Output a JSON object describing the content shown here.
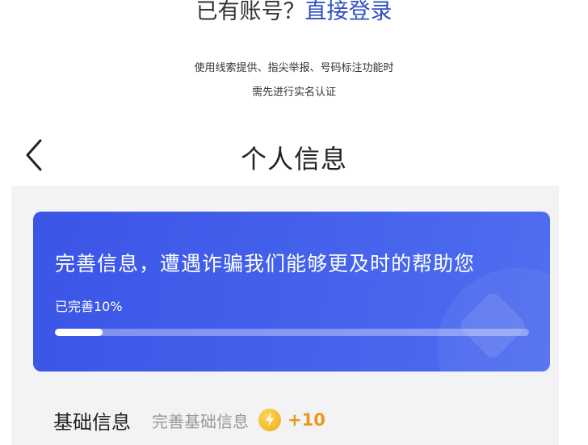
{
  "login": {
    "prompt": "已有账号？",
    "link": "直接登录"
  },
  "notice": {
    "line1": "使用线索提供、指尖举报、号码标注功能时",
    "line2": "需先进行实名认证"
  },
  "header": {
    "title": "个人信息"
  },
  "card": {
    "headline": "完善信息，遭遇诈骗我们能够更及时的帮助您",
    "progress_text": "已完善10%",
    "progress_fraction": 0.1
  },
  "basic_info": {
    "title": "基础信息",
    "hint": "完善基础信息",
    "reward": "+10",
    "coin_icon": "lightning-coin-icon"
  },
  "colors": {
    "link": "#2f4fc4",
    "card": "#4462ec",
    "reward": "#e79a1a"
  }
}
